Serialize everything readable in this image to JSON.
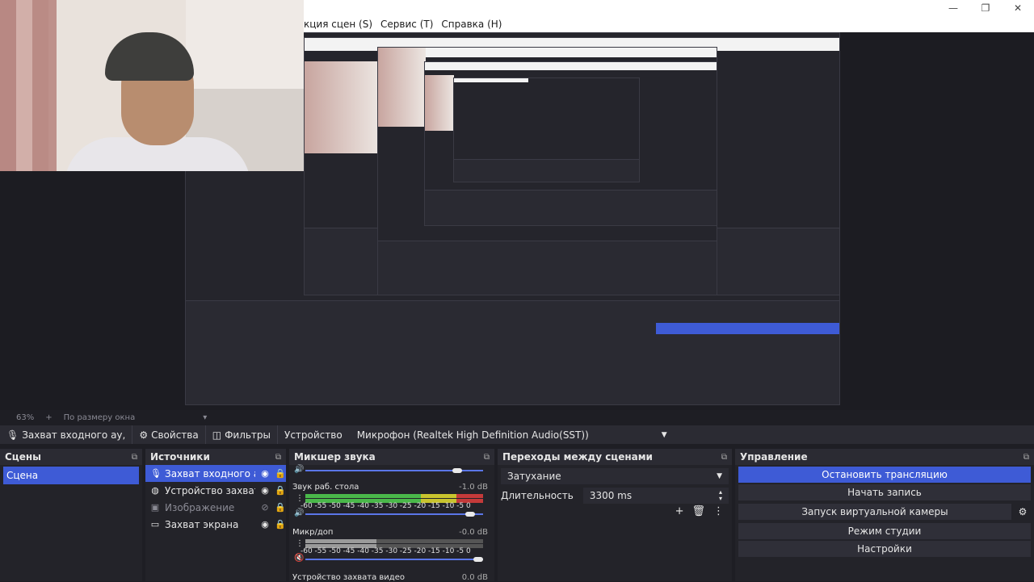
{
  "menu": {
    "items": [
      "кция сцен (S)",
      "Сервис (Т)",
      "Справка (Н)"
    ]
  },
  "window_controls": {
    "min": "—",
    "max": "❐",
    "close": "✕"
  },
  "status_bar": {
    "zoom": "63%",
    "plus": "+",
    "fit": "По размеру окна",
    "fit_arrow": "▾"
  },
  "toolbar": {
    "source_label": "Захват входного ау,",
    "properties": "Свойства",
    "filters": "Фильтры",
    "device_label": "Устройство",
    "device_value": "Микрофон (Realtek High Definition Audio(SST))"
  },
  "scenes": {
    "title": "Сцены",
    "items": [
      "Сцена"
    ]
  },
  "sources": {
    "title": "Источники",
    "items": [
      {
        "name": "Захват входного ауд",
        "icon": "mic-icon"
      },
      {
        "name": "Устройство захвата в",
        "icon": "camera-icon"
      },
      {
        "name": "Изображение",
        "icon": "image-icon"
      },
      {
        "name": "Захват экрана",
        "icon": "monitor-icon"
      }
    ]
  },
  "mixer": {
    "title": "Микшер звука",
    "tracks": [
      {
        "name": "Звук раб. стола",
        "db": "-1.0 dB",
        "level": 0.97
      },
      {
        "name": "Микр/доп",
        "db": "-0.0 dB",
        "level": 0.98
      },
      {
        "name": "Устройство захвата видео",
        "db": "0.0 dB",
        "level": 1.0
      }
    ],
    "scale": "-60 -55 -50 -45 -40 -35 -30 -25 -20 -15 -10 -5 0"
  },
  "transitions": {
    "title": "Переходы между сценами",
    "type": "Затухание",
    "duration_label": "Длительность",
    "duration_value": "3300 ms"
  },
  "controls": {
    "title": "Управление",
    "buttons": [
      "Остановить трансляцию",
      "Начать запись",
      "Запуск виртуальной камеры",
      "Режим студии",
      "Настройки"
    ]
  },
  "colors": {
    "accent": "#3e5bd6",
    "panel": "#232329",
    "bar": "#2b2b33"
  }
}
